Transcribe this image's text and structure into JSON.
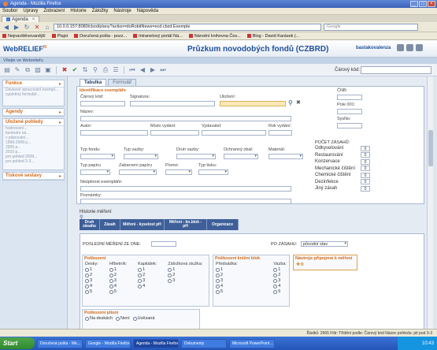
{
  "window": {
    "title": "Agenda - Mozilla Firefox"
  },
  "menu": [
    "Soubor",
    "Úpravy",
    "Zobrazení",
    "Historie",
    "Záložky",
    "Nástroje",
    "Nápověda"
  ],
  "browser_tab": {
    "label": "Agenda"
  },
  "address": {
    "url": "10.0.0.157:8080/cbzd/plany?action=doRobitNews=ecd.cbzd.Exemple",
    "search_placeholder": "Google"
  },
  "bookmarks": [
    "Nejnavštěvovanější",
    "Plajst",
    "Doručená pošta - pozz...",
    "Intranetový portál Ná...",
    "Národní knihovna Čes...",
    "Blog - David Karásek (..."
  ],
  "app": {
    "logo": "WebRELIEF",
    "logo_sup": "III",
    "title": "Průzkum novodobých fondů (CZBRD)",
    "user": "bastakovalenza",
    "breadcrumb": "Vítejte ve Webreliefu",
    "barcode_label": "Čárový kód:"
  },
  "sidebar": {
    "panels": [
      {
        "title": "Funkce",
        "items": [
          "Dávkové zpracování exempl...",
          "vyplněný formulář..."
        ]
      },
      {
        "title": "Agendy",
        "items": []
      },
      {
        "title": "Uložené pohledy",
        "items": [
          "hodnocení...",
          "kontrolní ná...",
          "v plánování...",
          "1999-2008 p...",
          "2005 p...",
          "2010 p...",
          "pro pohled 2009...",
          "pro pohled 2-3..."
        ]
      },
      {
        "title": "Tiskové sestavy",
        "items": []
      }
    ]
  },
  "form": {
    "tabs": [
      "Tabulka",
      "Formulář"
    ],
    "section_ident": "Identifikace exempláře",
    "labels": {
      "barcode": "Čárový kód:",
      "signature": "Signatura:",
      "location": "Uložení:",
      "title": "Název:",
      "author": "Autor:",
      "place": "Místo vydání:",
      "publisher": "Vydavatel:",
      "year": "Rok vydání:",
      "cnb": "ČNB:",
      "field001": "Pole 001:",
      "sysno": "SysNo:",
      "fund_type": "Typ fondu:",
      "binding_type": "Typ vazby:",
      "binding_kind": "Druh vazby:",
      "cover": "Ochranný obal:",
      "material": "Materiál:",
      "paper_type": "Typ papíru",
      "paper_bound": "Zabarvení papíru",
      "font": "Písmo:",
      "print_type": "Typ tisku:",
      "incomplete": "Neúplnost exempláře:",
      "notes": "Poznámky:"
    },
    "interventions": {
      "title": "POČET ZÁSAHŮ:",
      "rows": [
        {
          "label": "Odkyselování",
          "value": "0"
        },
        {
          "label": "Restaurování",
          "value": "0"
        },
        {
          "label": "Konzervace",
          "value": "0"
        },
        {
          "label": "Mechanické čištění",
          "value": "0"
        },
        {
          "label": "Chemické čištění",
          "value": "0"
        },
        {
          "label": "Dezinfekce",
          "value": "0"
        },
        {
          "label": "Jiný zásah",
          "value": "0"
        }
      ]
    }
  },
  "history": {
    "label": "Historie měření",
    "columns": [
      "Druh zásahu",
      "Zásah",
      "Měření - kyselost pH",
      "Měření - kn.blok - pH",
      "Organizace"
    ]
  },
  "lower": {
    "last_measure_label": "POSLEDNÍ MĚŘENÍ ZE DNE:",
    "after_intervention_label": "PO ZÁSAHU:",
    "after_intervention_value": "původní stav",
    "damage_title": "Poškození",
    "damage_cols": [
      "Desky:",
      "Hřbetník:",
      "Kapitálek:",
      "Záložková stužka:"
    ],
    "bookblock_title": "Poškození knižní blok",
    "bookblock_cols": [
      "Předsádka:",
      "Vazba:"
    ],
    "scale": [
      "1",
      "2",
      "3",
      "4",
      "5"
    ],
    "tools_title": "Nástroje připojené k měření",
    "mold_title": "Poškození plísní",
    "mold_options": [
      "Na deskách",
      "Není",
      "Uvězaná"
    ]
  },
  "status": {
    "text": "Řádků: 2965  Filtr: Třídění podle: Čárový kód  Název pohledu: pit pod 3-3"
  },
  "taskbar": {
    "start": "Start",
    "tasks": [
      "Doručená pošta - Mic...",
      "Google - Mozilla Firefox",
      "Agenda - Mozilla Firefox",
      "Dokumenty",
      "Microsoft PowerPoint ..."
    ],
    "clock": "10:43"
  }
}
